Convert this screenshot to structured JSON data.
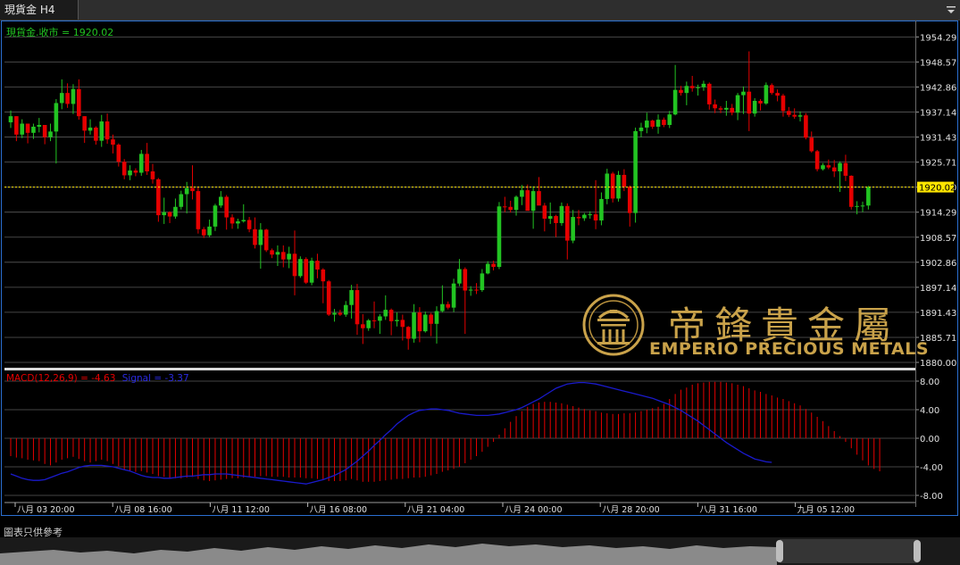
{
  "tab": {
    "title": "現貨金 H4",
    "menu_icon": "dropdown-arrow-icon"
  },
  "price_legend": "現貨金.收市 = 1920.02",
  "macd_legend": {
    "macd": "MACD(12,26,9) = -4.63",
    "signal": "Signal = -3.37"
  },
  "watermark": {
    "chinese": "帝鋒貴金屬",
    "english": "EMPERIO PRECIOUS METALS"
  },
  "footer_note": "圖表只供參考",
  "colors": {
    "up": "#22c422",
    "down": "#e60000",
    "signal": "#1a1acc",
    "macd_bar": "#e60000",
    "last_price": "#ffe600",
    "legend_price": "#22c422",
    "grid": "#5a5a5a",
    "gold": "#c9a24a"
  },
  "chart_data": [
    {
      "type": "candlestick",
      "timeframe": "H4",
      "ylim": [
        1880.0,
        1956.0
      ],
      "y_ticks": [
        "1954.29",
        "1948.57",
        "1942.86",
        "1937.14",
        "1931.43",
        "1925.71",
        "1920.00",
        "1914.29",
        "1908.57",
        "1902.86",
        "1897.14",
        "1891.43",
        "1885.71",
        "1880.00"
      ],
      "last_price": "1920.02",
      "x_tick_labels": [
        "八月 03 20:00",
        "八月 08 16:00",
        "八月 11 12:00",
        "八月 16 08:00",
        "八月 21 04:00",
        "八月 24 00:00",
        "八月 28 20:00",
        "八月 31 16:00",
        "九月 05 12:00"
      ],
      "ohlc": [
        [
          1934.8,
          1937.5,
          1933.5,
          1936.2
        ],
        [
          1936.2,
          1936.2,
          1930.5,
          1932.0
        ],
        [
          1932.0,
          1935.5,
          1931.2,
          1934.5
        ],
        [
          1934.5,
          1934.5,
          1930.0,
          1932.4
        ],
        [
          1932.4,
          1934.5,
          1931.0,
          1933.8
        ],
        [
          1933.8,
          1935.8,
          1932.5,
          1934.2
        ],
        [
          1934.2,
          1934.2,
          1929.8,
          1931.4
        ],
        [
          1931.4,
          1934.5,
          1930.5,
          1932.7
        ],
        [
          1932.7,
          1940.1,
          1925.4,
          1939.2
        ],
        [
          1939.2,
          1944.6,
          1937.8,
          1941.5
        ],
        [
          1941.5,
          1943.7,
          1938.1,
          1939.0
        ],
        [
          1939.0,
          1943.5,
          1936.7,
          1942.4
        ],
        [
          1942.4,
          1944.6,
          1935.4,
          1936.2
        ],
        [
          1936.2,
          1936.2,
          1930.1,
          1932.9
        ],
        [
          1932.9,
          1935.5,
          1932.0,
          1933.6
        ],
        [
          1933.6,
          1933.9,
          1929.7,
          1930.6
        ],
        [
          1930.6,
          1936.5,
          1929.2,
          1935.0
        ],
        [
          1935.0,
          1936.8,
          1929.9,
          1930.9
        ],
        [
          1930.9,
          1932.0,
          1927.7,
          1929.7
        ],
        [
          1929.7,
          1930.0,
          1924.7,
          1925.8
        ],
        [
          1925.8,
          1926.4,
          1921.8,
          1922.7
        ],
        [
          1922.7,
          1925.0,
          1921.6,
          1923.8
        ],
        [
          1923.8,
          1924.3,
          1922.5,
          1923.3
        ],
        [
          1923.3,
          1928.5,
          1922.6,
          1927.6
        ],
        [
          1927.6,
          1930.1,
          1922.8,
          1923.6
        ],
        [
          1923.6,
          1925.3,
          1920.8,
          1921.8
        ],
        [
          1921.8,
          1922.1,
          1912.1,
          1913.6
        ],
        [
          1913.6,
          1917.6,
          1911.6,
          1914.3
        ],
        [
          1914.3,
          1914.5,
          1911.8,
          1913.3
        ],
        [
          1913.3,
          1917.4,
          1912.8,
          1915.5
        ],
        [
          1915.5,
          1919.2,
          1914.9,
          1918.4
        ],
        [
          1918.4,
          1921.2,
          1914.0,
          1919.8
        ],
        [
          1919.8,
          1925.0,
          1917.2,
          1919.1
        ],
        [
          1919.1,
          1920.0,
          1909.4,
          1910.4
        ],
        [
          1910.4,
          1910.9,
          1908.4,
          1909.0
        ],
        [
          1909.0,
          1912.6,
          1908.6,
          1911.0
        ],
        [
          1911.0,
          1916.2,
          1910.0,
          1915.8
        ],
        [
          1915.8,
          1919.1,
          1915.3,
          1917.8
        ],
        [
          1917.8,
          1918.2,
          1910.3,
          1913.1
        ],
        [
          1913.1,
          1913.8,
          1910.5,
          1911.7
        ],
        [
          1911.7,
          1912.8,
          1910.5,
          1912.2
        ],
        [
          1912.2,
          1916.1,
          1911.9,
          1912.5
        ],
        [
          1912.5,
          1913.2,
          1909.7,
          1910.4
        ],
        [
          1910.4,
          1913.1,
          1906.0,
          1906.8
        ],
        [
          1906.8,
          1911.8,
          1901.4,
          1910.3
        ],
        [
          1910.3,
          1910.5,
          1905.2,
          1905.6
        ],
        [
          1905.6,
          1906.0,
          1903.8,
          1904.6
        ],
        [
          1904.6,
          1906.7,
          1902.0,
          1905.2
        ],
        [
          1905.2,
          1906.7,
          1901.7,
          1903.5
        ],
        [
          1903.5,
          1906.4,
          1901.5,
          1904.8
        ],
        [
          1904.8,
          1910.1,
          1895.3,
          1899.7
        ],
        [
          1899.7,
          1904.2,
          1899.3,
          1903.6
        ],
        [
          1903.6,
          1904.0,
          1897.9,
          1898.2
        ],
        [
          1898.2,
          1903.9,
          1897.6,
          1903.2
        ],
        [
          1903.2,
          1904.8,
          1899.2,
          1901.2
        ],
        [
          1901.2,
          1901.5,
          1893.5,
          1898.5
        ],
        [
          1898.5,
          1898.8,
          1890.6,
          1890.9
        ],
        [
          1890.9,
          1892.2,
          1889.3,
          1891.3
        ],
        [
          1891.3,
          1892.0,
          1890.6,
          1890.9
        ],
        [
          1890.9,
          1894.0,
          1890.4,
          1893.1
        ],
        [
          1893.1,
          1897.7,
          1890.0,
          1896.5
        ],
        [
          1896.5,
          1897.9,
          1886.3,
          1888.7
        ],
        [
          1888.7,
          1891.0,
          1884.2,
          1887.8
        ],
        [
          1887.8,
          1889.9,
          1887.2,
          1889.6
        ],
        [
          1889.6,
          1893.9,
          1887.8,
          1889.5
        ],
        [
          1889.5,
          1891.0,
          1886.5,
          1890.5
        ],
        [
          1890.5,
          1895.3,
          1889.7,
          1892.0
        ],
        [
          1892.0,
          1892.3,
          1886.2,
          1889.4
        ],
        [
          1889.4,
          1891.4,
          1888.2,
          1889.7
        ],
        [
          1889.7,
          1890.9,
          1885.0,
          1888.1
        ],
        [
          1888.1,
          1888.3,
          1882.9,
          1885.4
        ],
        [
          1885.4,
          1893.3,
          1884.5,
          1891.4
        ],
        [
          1891.4,
          1892.6,
          1884.6,
          1887.1
        ],
        [
          1887.1,
          1891.6,
          1886.8,
          1890.9
        ],
        [
          1890.9,
          1891.3,
          1886.0,
          1888.8
        ],
        [
          1888.8,
          1892.8,
          1884.3,
          1891.7
        ],
        [
          1891.7,
          1897.6,
          1891.4,
          1893.3
        ],
        [
          1893.3,
          1893.9,
          1892.1,
          1892.5
        ],
        [
          1892.5,
          1899.1,
          1891.5,
          1898.0
        ],
        [
          1898.0,
          1903.6,
          1897.4,
          1901.3
        ],
        [
          1901.3,
          1901.7,
          1886.5,
          1896.4
        ],
        [
          1896.4,
          1897.4,
          1895.2,
          1896.6
        ],
        [
          1896.6,
          1898.1,
          1895.6,
          1896.5
        ],
        [
          1896.5,
          1901.3,
          1896.1,
          1900.3
        ],
        [
          1900.3,
          1903.1,
          1900.1,
          1902.5
        ],
        [
          1902.5,
          1903.2,
          1901.0,
          1901.8
        ],
        [
          1901.8,
          1916.6,
          1901.3,
          1915.6
        ],
        [
          1915.6,
          1917.8,
          1914.3,
          1915.5
        ],
        [
          1915.5,
          1916.9,
          1914.2,
          1914.8
        ],
        [
          1914.8,
          1918.1,
          1913.5,
          1917.8
        ],
        [
          1917.8,
          1920.5,
          1915.9,
          1919.3
        ],
        [
          1919.3,
          1920.6,
          1917.6,
          1914.6
        ],
        [
          1914.6,
          1920.2,
          1910.5,
          1919.1
        ],
        [
          1919.1,
          1922.3,
          1916.5,
          1915.8
        ],
        [
          1915.8,
          1916.4,
          1909.9,
          1912.8
        ],
        [
          1912.8,
          1916.5,
          1911.6,
          1913.4
        ],
        [
          1913.4,
          1913.7,
          1908.6,
          1911.8
        ],
        [
          1911.8,
          1916.5,
          1911.2,
          1915.7
        ],
        [
          1915.7,
          1916.3,
          1903.5,
          1907.8
        ],
        [
          1907.8,
          1914.8,
          1907.2,
          1913.2
        ],
        [
          1913.2,
          1914.8,
          1911.3,
          1912.9
        ],
        [
          1912.9,
          1914.1,
          1912.3,
          1913.7
        ],
        [
          1913.7,
          1914.5,
          1912.8,
          1913.8
        ],
        [
          1913.8,
          1921.6,
          1910.4,
          1912.4
        ],
        [
          1912.4,
          1918.8,
          1911.3,
          1917.3
        ],
        [
          1917.3,
          1924.2,
          1916.1,
          1923.1
        ],
        [
          1923.1,
          1923.5,
          1916.5,
          1917.4
        ],
        [
          1917.4,
          1923.7,
          1916.7,
          1922.8
        ],
        [
          1922.8,
          1924.1,
          1919.1,
          1920.1
        ],
        [
          1920.1,
          1920.4,
          1911.0,
          1914.1
        ],
        [
          1914.1,
          1933.6,
          1911.9,
          1932.8
        ],
        [
          1932.8,
          1934.7,
          1931.4,
          1933.6
        ],
        [
          1933.6,
          1937.0,
          1932.3,
          1935.2
        ],
        [
          1935.2,
          1935.4,
          1933.3,
          1933.8
        ],
        [
          1933.8,
          1936.6,
          1932.2,
          1935.4
        ],
        [
          1935.4,
          1935.9,
          1933.7,
          1934.2
        ],
        [
          1934.2,
          1937.4,
          1933.5,
          1936.6
        ],
        [
          1936.6,
          1947.9,
          1936.4,
          1942.2
        ],
        [
          1942.2,
          1943.1,
          1940.9,
          1941.5
        ],
        [
          1941.5,
          1944.1,
          1938.7,
          1943.1
        ],
        [
          1943.1,
          1945.4,
          1941.8,
          1942.6
        ],
        [
          1942.6,
          1943.4,
          1940.9,
          1942.8
        ],
        [
          1942.8,
          1944.3,
          1942.0,
          1943.6
        ],
        [
          1943.6,
          1943.9,
          1937.7,
          1938.9
        ],
        [
          1938.9,
          1940.0,
          1936.9,
          1938.0
        ],
        [
          1938.0,
          1938.5,
          1936.9,
          1937.7
        ],
        [
          1937.7,
          1939.7,
          1936.3,
          1938.1
        ],
        [
          1938.1,
          1939.0,
          1936.4,
          1937.0
        ],
        [
          1937.0,
          1941.5,
          1935.3,
          1941.0
        ],
        [
          1941.0,
          1943.0,
          1936.7,
          1941.8
        ],
        [
          1941.8,
          1951.0,
          1932.8,
          1936.8
        ],
        [
          1936.8,
          1940.3,
          1936.1,
          1939.7
        ],
        [
          1939.7,
          1940.1,
          1937.5,
          1939.1
        ],
        [
          1939.1,
          1943.9,
          1938.8,
          1943.3
        ],
        [
          1943.3,
          1943.7,
          1941.1,
          1941.5
        ],
        [
          1941.5,
          1942.3,
          1939.6,
          1940.9
        ],
        [
          1940.9,
          1941.3,
          1936.1,
          1937.4
        ],
        [
          1937.4,
          1938.3,
          1936.0,
          1936.5
        ],
        [
          1936.5,
          1938.0,
          1935.6,
          1936.1
        ],
        [
          1936.1,
          1937.3,
          1935.0,
          1936.4
        ],
        [
          1936.4,
          1936.9,
          1930.9,
          1931.3
        ],
        [
          1931.3,
          1932.7,
          1927.9,
          1928.2
        ],
        [
          1928.2,
          1928.5,
          1923.6,
          1924.1
        ],
        [
          1924.1,
          1925.5,
          1923.8,
          1925.0
        ],
        [
          1925.0,
          1926.3,
          1924.1,
          1924.5
        ],
        [
          1924.5,
          1926.2,
          1922.3,
          1923.6
        ],
        [
          1923.6,
          1925.9,
          1918.9,
          1925.5
        ],
        [
          1925.5,
          1927.4,
          1921.4,
          1922.6
        ],
        [
          1922.6,
          1922.7,
          1914.9,
          1915.5
        ],
        [
          1915.5,
          1916.8,
          1913.8,
          1915.7
        ],
        [
          1915.7,
          1916.7,
          1914.3,
          1915.8
        ],
        [
          1915.8,
          1920.3,
          1914.9,
          1920.02
        ]
      ]
    },
    {
      "type": "macd",
      "params": "12,26,9",
      "ylim": [
        -9.0,
        9.0
      ],
      "y_ticks": [
        "8.00",
        "4.00",
        "0.00",
        "-4.00",
        "-8.00"
      ],
      "macd": [
        -2.5,
        -2.7,
        -2.8,
        -3.0,
        -3.1,
        -3.2,
        -3.6,
        -3.8,
        -3.4,
        -3.0,
        -2.8,
        -2.6,
        -2.9,
        -3.2,
        -3.4,
        -3.2,
        -3.0,
        -3.2,
        -3.6,
        -3.9,
        -4.4,
        -4.6,
        -4.7,
        -4.6,
        -4.8,
        -5.0,
        -5.3,
        -5.4,
        -5.6,
        -5.6,
        -5.6,
        -5.5,
        -5.4,
        -5.7,
        -5.9,
        -6.0,
        -5.9,
        -5.8,
        -5.7,
        -5.6,
        -5.6,
        -5.5,
        -5.4,
        -5.4,
        -5.3,
        -5.3,
        -5.4,
        -5.4,
        -5.4,
        -5.5,
        -5.5,
        -5.5,
        -5.6,
        -5.6,
        -5.7,
        -5.8,
        -6.0,
        -6.0,
        -6.0,
        -5.9,
        -5.7,
        -5.9,
        -6.1,
        -6.1,
        -6.1,
        -6.0,
        -5.9,
        -5.8,
        -5.7,
        -5.7,
        -5.6,
        -5.5,
        -5.5,
        -5.4,
        -5.2,
        -5.0,
        -4.7,
        -4.5,
        -4.3,
        -4.0,
        -3.5,
        -3.0,
        -2.5,
        -1.9,
        -1.2,
        -0.5,
        0.5,
        1.4,
        2.3,
        3.1,
        3.8,
        4.4,
        4.8,
        5.0,
        5.1,
        5.1,
        5.0,
        4.9,
        4.7,
        4.5,
        4.3,
        4.1,
        3.9,
        3.8,
        3.6,
        3.5,
        3.4,
        3.4,
        3.5,
        3.5,
        3.6,
        3.8,
        4.0,
        4.2,
        4.4,
        4.8,
        5.5,
        6.2,
        6.8,
        7.1,
        7.5,
        7.7,
        7.8,
        7.9,
        7.9,
        7.9,
        7.8,
        7.7,
        7.5,
        7.3,
        7.0,
        6.7,
        6.5,
        6.2,
        6.0,
        5.7,
        5.5,
        5.2,
        4.9,
        4.6,
        4.1,
        3.6,
        3.0,
        2.4,
        1.7,
        1.0,
        0.3,
        -0.5,
        -1.4,
        -2.3,
        -3.1,
        -3.8,
        -4.3,
        -4.63
      ],
      "signal": [
        -5.0,
        -5.3,
        -5.6,
        -5.8,
        -5.9,
        -5.9,
        -5.8,
        -5.5,
        -5.2,
        -4.9,
        -4.7,
        -4.4,
        -4.1,
        -3.9,
        -3.8,
        -3.8,
        -3.8,
        -3.9,
        -4.0,
        -4.2,
        -4.4,
        -4.6,
        -4.9,
        -5.2,
        -5.4,
        -5.5,
        -5.5,
        -5.6,
        -5.6,
        -5.5,
        -5.4,
        -5.3,
        -5.3,
        -5.2,
        -5.1,
        -5.1,
        -5.0,
        -5.0,
        -5.0,
        -5.1,
        -5.2,
        -5.3,
        -5.4,
        -5.5,
        -5.6,
        -5.7,
        -5.8,
        -5.9,
        -6.0,
        -6.1,
        -6.2,
        -6.3,
        -6.4,
        -6.2,
        -6.0,
        -5.8,
        -5.5,
        -5.2,
        -4.8,
        -4.4,
        -3.8,
        -3.2,
        -2.5,
        -1.8,
        -1.0,
        -0.3,
        0.5,
        1.2,
        2.0,
        2.6,
        3.2,
        3.6,
        3.9,
        4.0,
        4.1,
        4.1,
        4.0,
        3.9,
        3.7,
        3.5,
        3.4,
        3.3,
        3.2,
        3.2,
        3.2,
        3.3,
        3.4,
        3.6,
        3.8,
        4.0,
        4.3,
        4.7,
        5.1,
        5.5,
        6.0,
        6.5,
        7.0,
        7.3,
        7.6,
        7.7,
        7.8,
        7.8,
        7.7,
        7.6,
        7.4,
        7.2,
        7.0,
        6.8,
        6.6,
        6.4,
        6.2,
        6.0,
        5.8,
        5.6,
        5.3,
        5.0,
        4.7,
        4.3,
        3.9,
        3.4,
        2.9,
        2.4,
        1.8,
        1.2,
        0.6,
        0.0,
        -0.6,
        -1.1,
        -1.6,
        -2.1,
        -2.5,
        -2.9,
        -3.1,
        -3.3,
        -3.37
      ]
    }
  ]
}
